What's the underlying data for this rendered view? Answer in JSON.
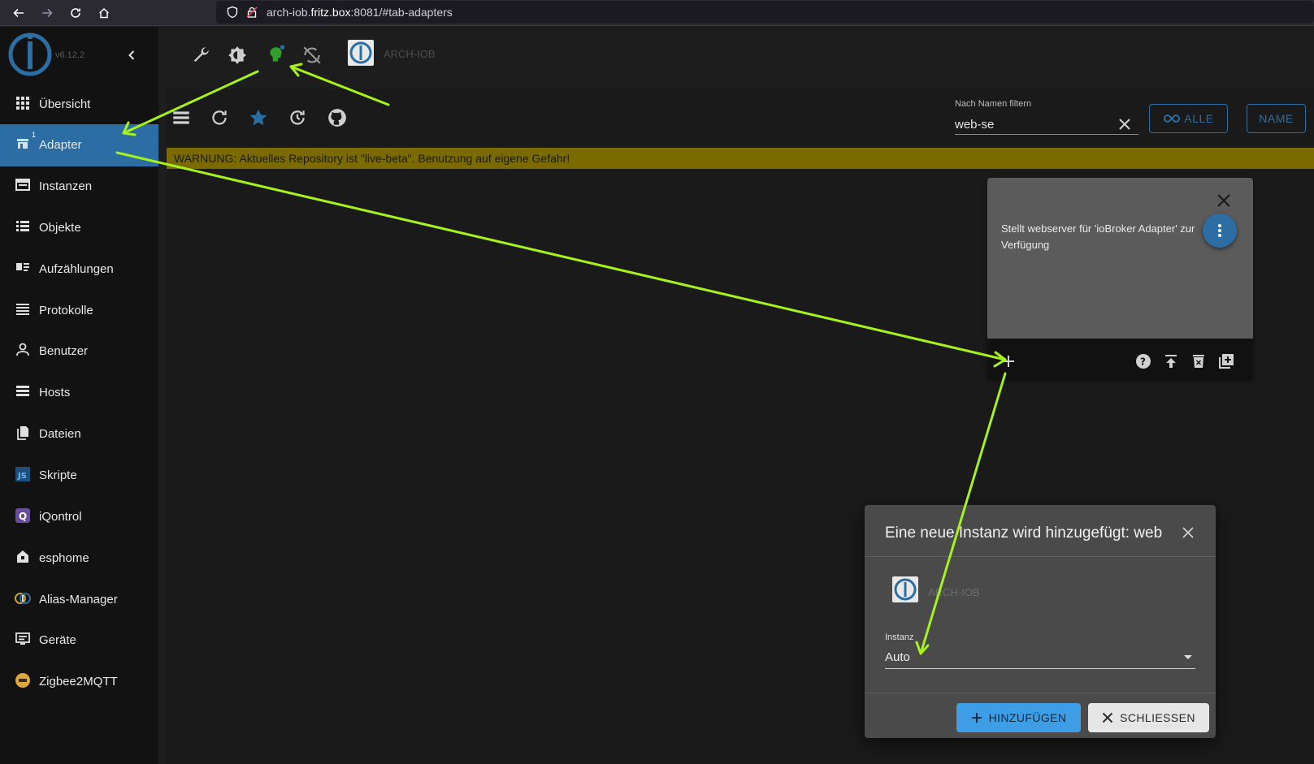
{
  "browser": {
    "url_prefix": "arch-iob.",
    "url_domain": "fritz.box",
    "url_suffix": ":8081/#tab-adapters"
  },
  "sidebar": {
    "version": "v6.12.2",
    "items": [
      {
        "label": "Übersicht",
        "icon": "grid-icon"
      },
      {
        "label": "Adapter",
        "icon": "store-icon",
        "badge": "1",
        "active": true
      },
      {
        "label": "Instanzen",
        "icon": "instances-icon"
      },
      {
        "label": "Objekte",
        "icon": "list-icon"
      },
      {
        "label": "Aufzählungen",
        "icon": "enum-icon"
      },
      {
        "label": "Protokolle",
        "icon": "log-icon"
      },
      {
        "label": "Benutzer",
        "icon": "user-icon"
      },
      {
        "label": "Hosts",
        "icon": "host-icon"
      },
      {
        "label": "Dateien",
        "icon": "files-icon"
      },
      {
        "label": "Skripte",
        "icon": "js-icon"
      },
      {
        "label": "iQontrol",
        "icon": "iqontrol-icon"
      },
      {
        "label": "esphome",
        "icon": "esphome-icon"
      },
      {
        "label": "Alias-Manager",
        "icon": "alias-icon"
      },
      {
        "label": "Geräte",
        "icon": "devices-icon"
      },
      {
        "label": "Zigbee2MQTT",
        "icon": "zigbee-icon"
      }
    ]
  },
  "topbar": {
    "host_name": "ARCH-IOB"
  },
  "toolbar": {
    "filter_label": "Nach Namen filtern",
    "filter_value": "web-se",
    "all_label": "ALLE",
    "name_label": "NAME"
  },
  "warning": {
    "text": "WARNUNG: Aktuelles Repository ist \"live-beta\". Benutzung auf eigene Gefahr!",
    "color": "#7a6a00"
  },
  "card": {
    "description": "Stellt webserver für 'ioBroker Adapter' zur Verfügung"
  },
  "dialog": {
    "title": "Eine neue Instanz wird hinzugefügt: web",
    "host_name": "ARCH-IOB",
    "instance_label": "Instanz",
    "instance_value": "Auto",
    "add_label": "HINZUFÜGEN",
    "close_label": "SCHLIESSEN"
  },
  "colors": {
    "accent": "#2c6ea3",
    "annotation_arrow": "#a6f21a"
  }
}
